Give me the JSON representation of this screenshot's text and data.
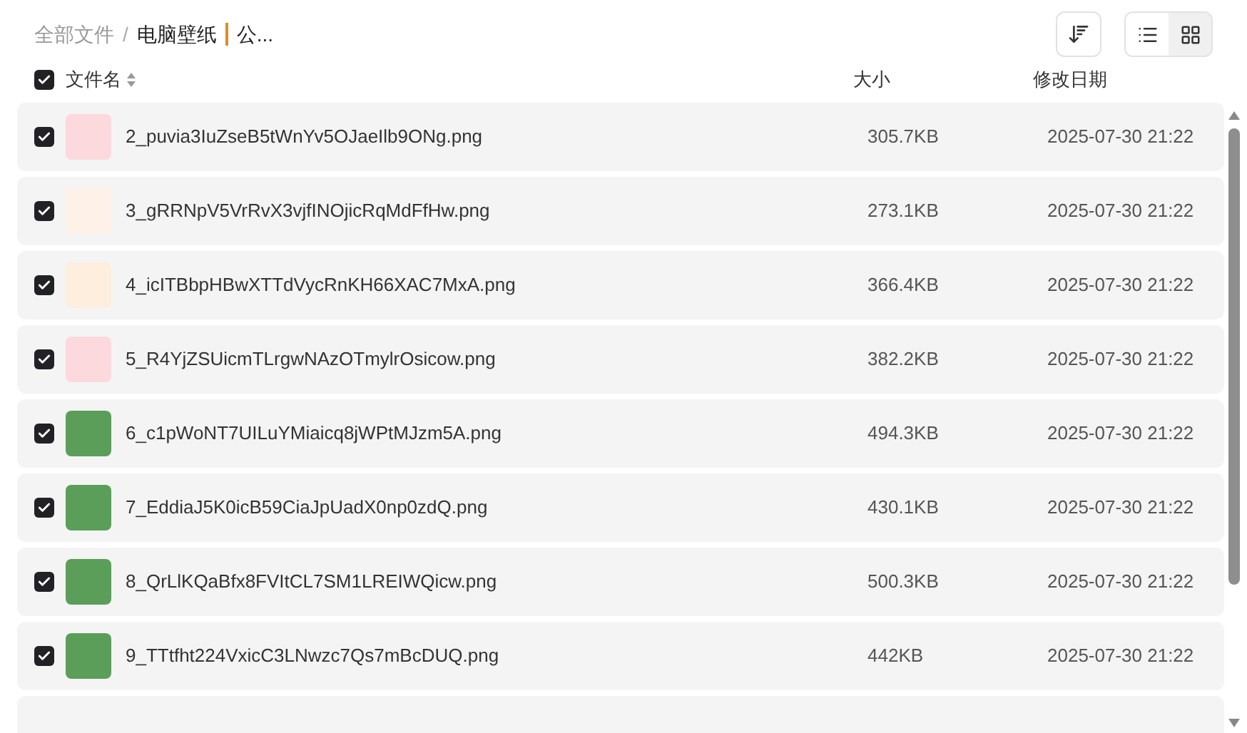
{
  "breadcrumb": {
    "root": "全部文件",
    "separator": "/",
    "current": "电脑壁纸",
    "tail": "公..."
  },
  "views": [
    {
      "kind": "list",
      "selected": false
    },
    {
      "kind": "grid",
      "selected": true
    }
  ],
  "header": {
    "checked": true,
    "columns": [
      "文件名",
      "大小",
      "修改日期"
    ]
  },
  "rows": [
    {
      "checked": true,
      "color": "#fbd9dc",
      "name": "2_puvia3IuZseB5tWnYv5OJaeIlb9ONg.png",
      "size": "305.7KB",
      "date": "2025-07-30 21:22"
    },
    {
      "checked": true,
      "color": "#fdf1e8",
      "name": "3_gRRNpV5VrRvX3vjfINOjicRqMdFfHw.png",
      "size": "273.1KB",
      "date": "2025-07-30 21:22"
    },
    {
      "checked": true,
      "color": "#fdeedd",
      "name": "4_icITBbpHBwXTTdVycRnKH66XAC7MxA.png",
      "size": "366.4KB",
      "date": "2025-07-30 21:22"
    },
    {
      "checked": true,
      "color": "#fbd9dc",
      "name": "5_R4YjZSUicmTLrgwNAzOTmylrOsicow.png",
      "size": "382.2KB",
      "date": "2025-07-30 21:22"
    },
    {
      "checked": true,
      "color": "#5a9e5a",
      "name": "6_c1pWoNT7UILuYMiaicq8jWPtMJzm5A.png",
      "size": "494.3KB",
      "date": "2025-07-30 21:22"
    },
    {
      "checked": true,
      "color": "#5a9e5a",
      "name": "7_EddiaJ5K0icB59CiaJpUadX0np0zdQ.png",
      "size": "430.1KB",
      "date": "2025-07-30 21:22"
    },
    {
      "checked": true,
      "color": "#5a9e5a",
      "name": "8_QrLlKQaBfx8FVItCL7SM1LREIWQicw.png",
      "size": "500.3KB",
      "date": "2025-07-30 21:22"
    },
    {
      "checked": true,
      "color": "#5a9e5a",
      "name": "9_TTtfht224VxicC3LNwzc7Qs7mBcDUQ.png",
      "size": "442KB",
      "date": "2025-07-30 21:22"
    }
  ]
}
